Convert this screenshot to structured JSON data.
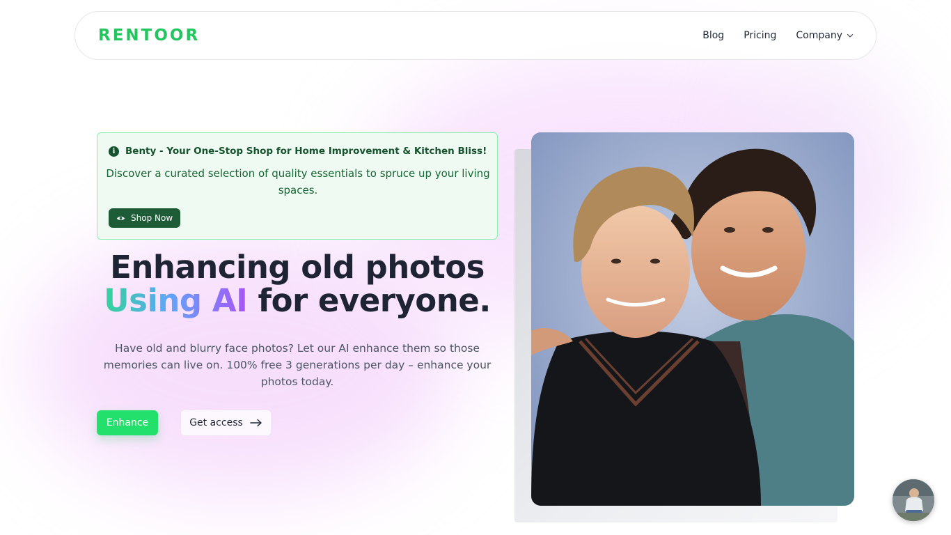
{
  "brand": {
    "logo_text": "RENTOOR",
    "color": "#22c55e"
  },
  "nav": {
    "items": [
      {
        "label": "Blog"
      },
      {
        "label": "Pricing"
      },
      {
        "label": "Company"
      }
    ],
    "company_icon": "chevron-down-icon"
  },
  "promo": {
    "icon": "info-icon",
    "title": "Benty - Your One-Stop Shop for Home Improvement & Kitchen Bliss!",
    "description": "Discover a curated selection of quality essentials to spruce up your living spaces.",
    "button_label": "Shop Now",
    "button_icon": "eye-icon",
    "background": "#effbf2",
    "border": "#86efac"
  },
  "hero": {
    "title_line1": "Enhancing old photos",
    "title_grad": "Using AI",
    "title_line2_rest": " for everyone.",
    "subtitle": "Have old and blurry face photos? Let our AI enhance them so those memories can live on. 100% free 3 generations per day – enhance your photos today.",
    "primary_button": "Enhance",
    "secondary_button": "Get access",
    "secondary_icon": "arrow-right-icon",
    "accent": "#22e06b"
  },
  "media": {
    "hero_image": "restored-photo-two-boys",
    "chat_avatar": "chat-avatar-photo"
  }
}
